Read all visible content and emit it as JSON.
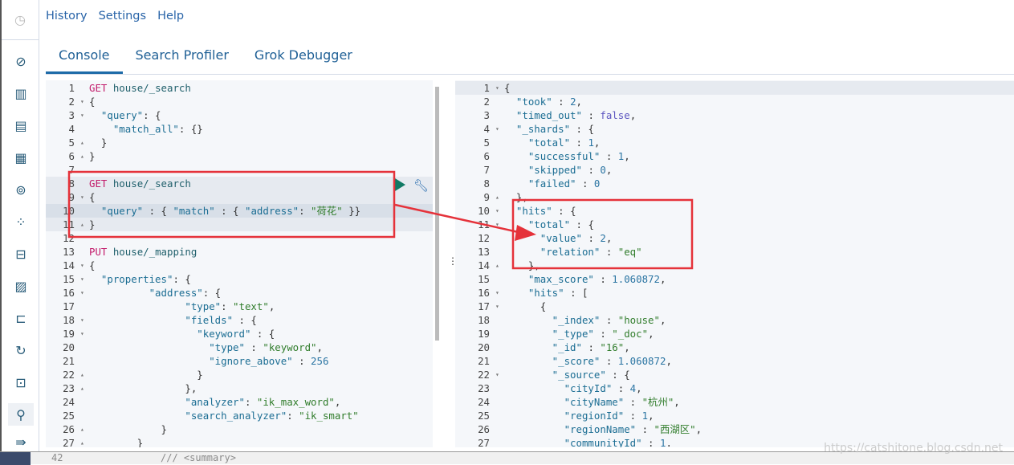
{
  "sidebar": {
    "top_icon": "clock-icon",
    "items": [
      "compass-icon",
      "visualize-icon",
      "dashboard-icon",
      "canvas-icon",
      "maps-icon",
      "ml-icon",
      "infrastructure-icon",
      "logs-icon",
      "apm-icon",
      "uptime-icon",
      "security-icon",
      "dev-tools-icon",
      "collapse-icon"
    ],
    "active": "dev-tools-icon"
  },
  "menu": {
    "history": "History",
    "settings": "Settings",
    "help": "Help"
  },
  "tabs": [
    {
      "label": "Console",
      "active": true
    },
    {
      "label": "Search Profiler"
    },
    {
      "label": "Grok Debugger"
    }
  ],
  "request_editor": {
    "lines": [
      {
        "n": "1",
        "t": [
          [
            "m",
            "GET"
          ],
          [
            "u",
            " house/_search"
          ]
        ]
      },
      {
        "n": "2",
        "f": "down",
        "t": [
          [
            "p",
            "{"
          ]
        ]
      },
      {
        "n": "3",
        "f": "down",
        "t": [
          [
            "k",
            "  \"query\""
          ],
          [
            "p",
            ": {"
          ]
        ]
      },
      {
        "n": "4",
        "t": [
          [
            "k",
            "    \"match_all\""
          ],
          [
            "p",
            ": {}"
          ]
        ]
      },
      {
        "n": "5",
        "f": "up",
        "t": [
          [
            "p",
            "  }"
          ]
        ]
      },
      {
        "n": "6",
        "f": "up",
        "t": [
          [
            "p",
            "}"
          ]
        ]
      },
      {
        "n": "7",
        "t": []
      },
      {
        "n": "8",
        "t": [
          [
            "m",
            "GET"
          ],
          [
            "u",
            " house/_search"
          ]
        ]
      },
      {
        "n": "9",
        "f": "down",
        "t": [
          [
            "p",
            "{"
          ]
        ]
      },
      {
        "n": "10",
        "t": [
          [
            "k",
            "  \"query\""
          ],
          [
            "p",
            " : { "
          ],
          [
            "k",
            "\"match\""
          ],
          [
            "p",
            " : { "
          ],
          [
            "k",
            "\"address\""
          ],
          [
            "p",
            ": "
          ],
          [
            "s",
            "\"荷花\""
          ],
          [
            "p",
            " }}"
          ]
        ]
      },
      {
        "n": "11",
        "f": "up",
        "t": [
          [
            "p",
            "}"
          ]
        ]
      },
      {
        "n": "12",
        "t": []
      },
      {
        "n": "13",
        "t": [
          [
            "m",
            "PUT"
          ],
          [
            "u",
            " house/_mapping"
          ]
        ]
      },
      {
        "n": "14",
        "f": "down",
        "t": [
          [
            "p",
            "{"
          ]
        ]
      },
      {
        "n": "15",
        "f": "down",
        "t": [
          [
            "k",
            "  \"properties\""
          ],
          [
            "p",
            ": {"
          ]
        ]
      },
      {
        "n": "16",
        "f": "down",
        "t": [
          [
            "k",
            "          \"address\""
          ],
          [
            "p",
            ": {"
          ]
        ]
      },
      {
        "n": "17",
        "t": [
          [
            "k",
            "                \"type\""
          ],
          [
            "p",
            ": "
          ],
          [
            "s",
            "\"text\""
          ],
          [
            "p",
            ","
          ]
        ]
      },
      {
        "n": "18",
        "f": "down",
        "t": [
          [
            "k",
            "                \"fields\""
          ],
          [
            "p",
            " : {"
          ]
        ]
      },
      {
        "n": "19",
        "f": "down",
        "t": [
          [
            "k",
            "                  \"keyword\""
          ],
          [
            "p",
            " : {"
          ]
        ]
      },
      {
        "n": "20",
        "t": [
          [
            "k",
            "                    \"type\""
          ],
          [
            "p",
            " : "
          ],
          [
            "s",
            "\"keyword\""
          ],
          [
            "p",
            ","
          ]
        ]
      },
      {
        "n": "21",
        "t": [
          [
            "k",
            "                    \"ignore_above\""
          ],
          [
            "p",
            " : "
          ],
          [
            "n",
            "256"
          ]
        ]
      },
      {
        "n": "22",
        "f": "up",
        "t": [
          [
            "p",
            "                  }"
          ]
        ]
      },
      {
        "n": "23",
        "f": "up",
        "t": [
          [
            "p",
            "                },"
          ]
        ]
      },
      {
        "n": "24",
        "t": [
          [
            "k",
            "                \"analyzer\""
          ],
          [
            "p",
            ": "
          ],
          [
            "s",
            "\"ik_max_word\""
          ],
          [
            "p",
            ","
          ]
        ]
      },
      {
        "n": "25",
        "t": [
          [
            "k",
            "                \"search_analyzer\""
          ],
          [
            "p",
            ": "
          ],
          [
            "s",
            "\"ik_smart\""
          ]
        ]
      },
      {
        "n": "26",
        "f": "up",
        "t": [
          [
            "p",
            "            }"
          ]
        ]
      },
      {
        "n": "27",
        "f": "up",
        "t": [
          [
            "p",
            "        }"
          ]
        ]
      }
    ]
  },
  "response_editor": {
    "lines": [
      {
        "n": "1",
        "f": "down",
        "t": [
          [
            "p",
            "{"
          ]
        ]
      },
      {
        "n": "2",
        "t": [
          [
            "k",
            "  \"took\""
          ],
          [
            "p",
            " : "
          ],
          [
            "n",
            "2"
          ],
          [
            "p",
            ","
          ]
        ]
      },
      {
        "n": "3",
        "t": [
          [
            "k",
            "  \"timed_out\""
          ],
          [
            "p",
            " : "
          ],
          [
            "b",
            "false"
          ],
          [
            "p",
            ","
          ]
        ]
      },
      {
        "n": "4",
        "f": "down",
        "t": [
          [
            "k",
            "  \"_shards\""
          ],
          [
            "p",
            " : {"
          ]
        ]
      },
      {
        "n": "5",
        "t": [
          [
            "k",
            "    \"total\""
          ],
          [
            "p",
            " : "
          ],
          [
            "n",
            "1"
          ],
          [
            "p",
            ","
          ]
        ]
      },
      {
        "n": "6",
        "t": [
          [
            "k",
            "    \"successful\""
          ],
          [
            "p",
            " : "
          ],
          [
            "n",
            "1"
          ],
          [
            "p",
            ","
          ]
        ]
      },
      {
        "n": "7",
        "t": [
          [
            "k",
            "    \"skipped\""
          ],
          [
            "p",
            " : "
          ],
          [
            "n",
            "0"
          ],
          [
            "p",
            ","
          ]
        ]
      },
      {
        "n": "8",
        "t": [
          [
            "k",
            "    \"failed\""
          ],
          [
            "p",
            " : "
          ],
          [
            "n",
            "0"
          ]
        ]
      },
      {
        "n": "9",
        "f": "up",
        "t": [
          [
            "p",
            "  },"
          ]
        ]
      },
      {
        "n": "10",
        "f": "down",
        "t": [
          [
            "k",
            "  \"hits\""
          ],
          [
            "p",
            " : {"
          ]
        ]
      },
      {
        "n": "11",
        "f": "down",
        "t": [
          [
            "k",
            "    \"total\""
          ],
          [
            "p",
            " : {"
          ]
        ]
      },
      {
        "n": "12",
        "t": [
          [
            "k",
            "      \"value\""
          ],
          [
            "p",
            " : "
          ],
          [
            "n",
            "2"
          ],
          [
            "p",
            ","
          ]
        ]
      },
      {
        "n": "13",
        "t": [
          [
            "k",
            "      \"relation\""
          ],
          [
            "p",
            " : "
          ],
          [
            "s",
            "\"eq\""
          ]
        ]
      },
      {
        "n": "14",
        "f": "up",
        "t": [
          [
            "p",
            "    },"
          ]
        ]
      },
      {
        "n": "15",
        "t": [
          [
            "k",
            "    \"max_score\""
          ],
          [
            "p",
            " : "
          ],
          [
            "n",
            "1.060872"
          ],
          [
            "p",
            ","
          ]
        ]
      },
      {
        "n": "16",
        "f": "down",
        "t": [
          [
            "k",
            "    \"hits\""
          ],
          [
            "p",
            " : ["
          ]
        ]
      },
      {
        "n": "17",
        "f": "down",
        "t": [
          [
            "p",
            "      {"
          ]
        ]
      },
      {
        "n": "18",
        "t": [
          [
            "k",
            "        \"_index\""
          ],
          [
            "p",
            " : "
          ],
          [
            "s",
            "\"house\""
          ],
          [
            "p",
            ","
          ]
        ]
      },
      {
        "n": "19",
        "t": [
          [
            "k",
            "        \"_type\""
          ],
          [
            "p",
            " : "
          ],
          [
            "s",
            "\"_doc\""
          ],
          [
            "p",
            ","
          ]
        ]
      },
      {
        "n": "20",
        "t": [
          [
            "k",
            "        \"_id\""
          ],
          [
            "p",
            " : "
          ],
          [
            "s",
            "\"16\""
          ],
          [
            "p",
            ","
          ]
        ]
      },
      {
        "n": "21",
        "t": [
          [
            "k",
            "        \"_score\""
          ],
          [
            "p",
            " : "
          ],
          [
            "n",
            "1.060872"
          ],
          [
            "p",
            ","
          ]
        ]
      },
      {
        "n": "22",
        "f": "down",
        "t": [
          [
            "k",
            "        \"_source\""
          ],
          [
            "p",
            " : {"
          ]
        ]
      },
      {
        "n": "23",
        "t": [
          [
            "k",
            "          \"cityId\""
          ],
          [
            "p",
            " : "
          ],
          [
            "n",
            "4"
          ],
          [
            "p",
            ","
          ]
        ]
      },
      {
        "n": "24",
        "t": [
          [
            "k",
            "          \"cityName\""
          ],
          [
            "p",
            " : "
          ],
          [
            "s",
            "\"杭州\""
          ],
          [
            "p",
            ","
          ]
        ]
      },
      {
        "n": "25",
        "t": [
          [
            "k",
            "          \"regionId\""
          ],
          [
            "p",
            " : "
          ],
          [
            "n",
            "1"
          ],
          [
            "p",
            ","
          ]
        ]
      },
      {
        "n": "26",
        "t": [
          [
            "k",
            "          \"regionName\""
          ],
          [
            "p",
            " : "
          ],
          [
            "s",
            "\"西湖区\""
          ],
          [
            "p",
            ","
          ]
        ]
      },
      {
        "n": "27",
        "t": [
          [
            "k",
            "          \"communityId\""
          ],
          [
            "p",
            " : "
          ],
          [
            "n",
            "1"
          ],
          [
            "p",
            "."
          ]
        ]
      }
    ]
  },
  "bottom_window": {
    "line_number": "42",
    "text": "/// <summary>"
  },
  "watermark": "https://catshitone.blog.csdn.net",
  "colors": {
    "annotation": "#e5323a",
    "accent": "#1e6ba8",
    "run": "#117a65"
  }
}
